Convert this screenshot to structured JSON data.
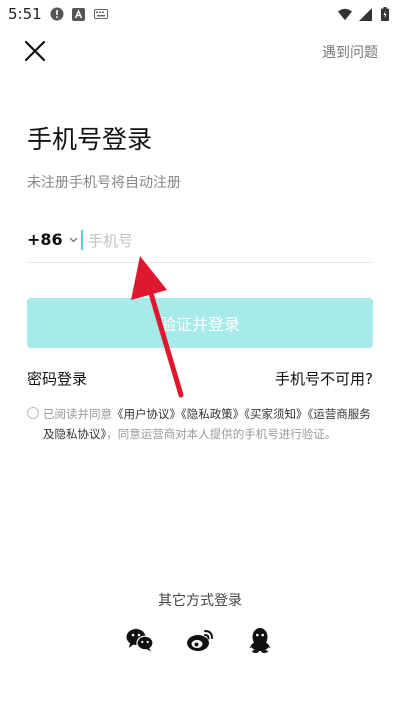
{
  "status_bar": {
    "time": "5:51"
  },
  "header": {
    "help": "遇到问题"
  },
  "title": "手机号登录",
  "subtitle": "未注册手机号将自动注册",
  "phone": {
    "country_code": "+86",
    "placeholder": "手机号",
    "value": ""
  },
  "login_button": "验证并登录",
  "links": {
    "password_login": "密码登录",
    "phone_unavailable": "手机号不可用?"
  },
  "agreement": {
    "prefix": "已阅读并同意",
    "user_agreement": "《用户协议》",
    "privacy_policy": "《隐私政策》",
    "buyer_notice": "《买家须知》",
    "carrier_agreement": "《运营商服务及隐私协议》",
    "suffix": "，同意运营商对本人提供的手机号进行验证。"
  },
  "other_login": {
    "title": "其它方式登录"
  },
  "icons": {
    "close": "close-icon",
    "wechat": "wechat-icon",
    "weibo": "weibo-icon",
    "qq": "qq-icon",
    "arrow": "red-arrow-annotation"
  },
  "colors": {
    "accent": "#5ad3d3",
    "button_bg": "#a6eaea",
    "annotation": "#e0182d"
  }
}
